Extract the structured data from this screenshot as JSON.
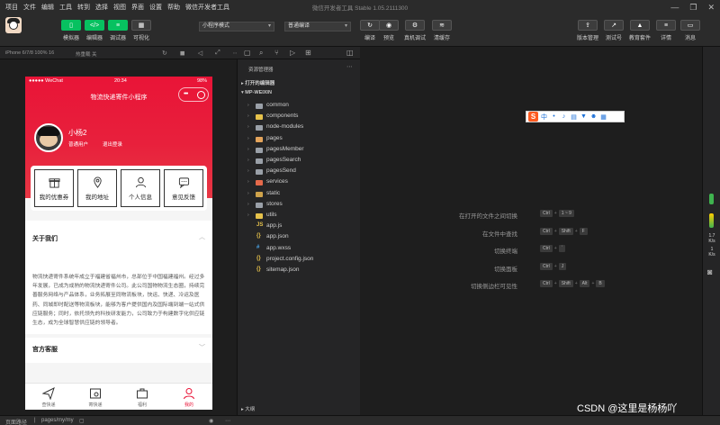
{
  "menu": [
    "项目",
    "文件",
    "编辑",
    "工具",
    "转到",
    "选择",
    "视图",
    "界面",
    "设置",
    "帮助",
    "微信开发者工具"
  ],
  "window_title": "微信开发者工具 Stable 1.05.2111300",
  "toolbar": {
    "left_buttons": [
      {
        "label": "模拟器",
        "icon": "phone-icon"
      },
      {
        "label": "编辑器",
        "icon": "code-icon"
      },
      {
        "label": "调试器",
        "icon": "debug-icon"
      },
      {
        "label": "可视化",
        "icon": "visual-icon"
      }
    ],
    "mode_select": "小程序模式",
    "compile_select": "普通编译",
    "mid_buttons": [
      "编译",
      "预览",
      "真机调试",
      "清缓存"
    ],
    "right_buttons": [
      "版本管理",
      "测试号",
      "教育套件",
      "详情",
      "消息"
    ]
  },
  "simulator": {
    "device": "iPhone 6/7/8 100% 16",
    "hotreload": "热重载 关",
    "status_left": "●●●●● WeChat",
    "status_time": "20:34",
    "status_battery": "98%",
    "nav_title": "物流快递寄件小程序",
    "user_name": "小杨2",
    "user_type": "普通用户",
    "logout": "退出登录",
    "grid": [
      "我的优惠券",
      "我的地址",
      "个人信息",
      "意见反馈"
    ],
    "about_title": "关于我们",
    "about_text": "物流快递寄件系统年成立于福建省福州市，总部位于中国福建福州。经过多年发展，已成为成熟的物流快递寄件公司。此公司国物物流生态圈，持续完善服务网络与产品体系，业务拓展至同物流板块，快运、快递、冷运及医药、同城即时配送等物流板块，能够为客户提供国内及国际端到端一站式供应链服务；同时，依托领先的科技研发能力，公司致力于构建数字化供应链生态，成为全球智慧供应链的领导者。",
    "service_title": "官方客服",
    "tabs": [
      "查快递",
      "寄快递",
      "福利",
      "我的"
    ]
  },
  "explorer": {
    "title": "资源管理器",
    "open_editors": "打开的编辑器",
    "project": "MP-WEIXIN",
    "folders": [
      "common",
      "components",
      "node-modules",
      "pages",
      "pagesMember",
      "pagesSearch",
      "pagesSend",
      "services",
      "static",
      "stores",
      "utils"
    ],
    "files": [
      {
        "name": "app.js",
        "icon": "js-file-icon"
      },
      {
        "name": "app.json",
        "icon": "json-file-icon"
      },
      {
        "name": "app.wxss",
        "icon": "wxss-file-icon"
      },
      {
        "name": "project.config.json",
        "icon": "json-file-icon"
      },
      {
        "name": "sitemap.json",
        "icon": "json-file-icon"
      }
    ],
    "outline": "大纲"
  },
  "editor": {
    "ime": "中",
    "shortcuts": [
      {
        "label": "在打开的文件之间切换",
        "keys": [
          "Ctrl",
          "1 ~ 9"
        ]
      },
      {
        "label": "在文件中查找",
        "keys": [
          "Ctrl",
          "Shift",
          "F"
        ]
      },
      {
        "label": "切换终端",
        "keys": [
          "Ctrl",
          "`"
        ]
      },
      {
        "label": "切换面板",
        "keys": [
          "Ctrl",
          "J"
        ]
      },
      {
        "label": "切换侧边栏可见性",
        "keys": [
          "Ctrl",
          "Shift",
          "Alt",
          "B"
        ]
      }
    ]
  },
  "rail": {
    "v1": "1.7",
    "u1": "K/s",
    "v2": "1",
    "u2": "K/s"
  },
  "statusbar": {
    "path_label": "页面路径",
    "path": "pages/my/my"
  },
  "watermark": "CSDN @这里是杨杨吖"
}
